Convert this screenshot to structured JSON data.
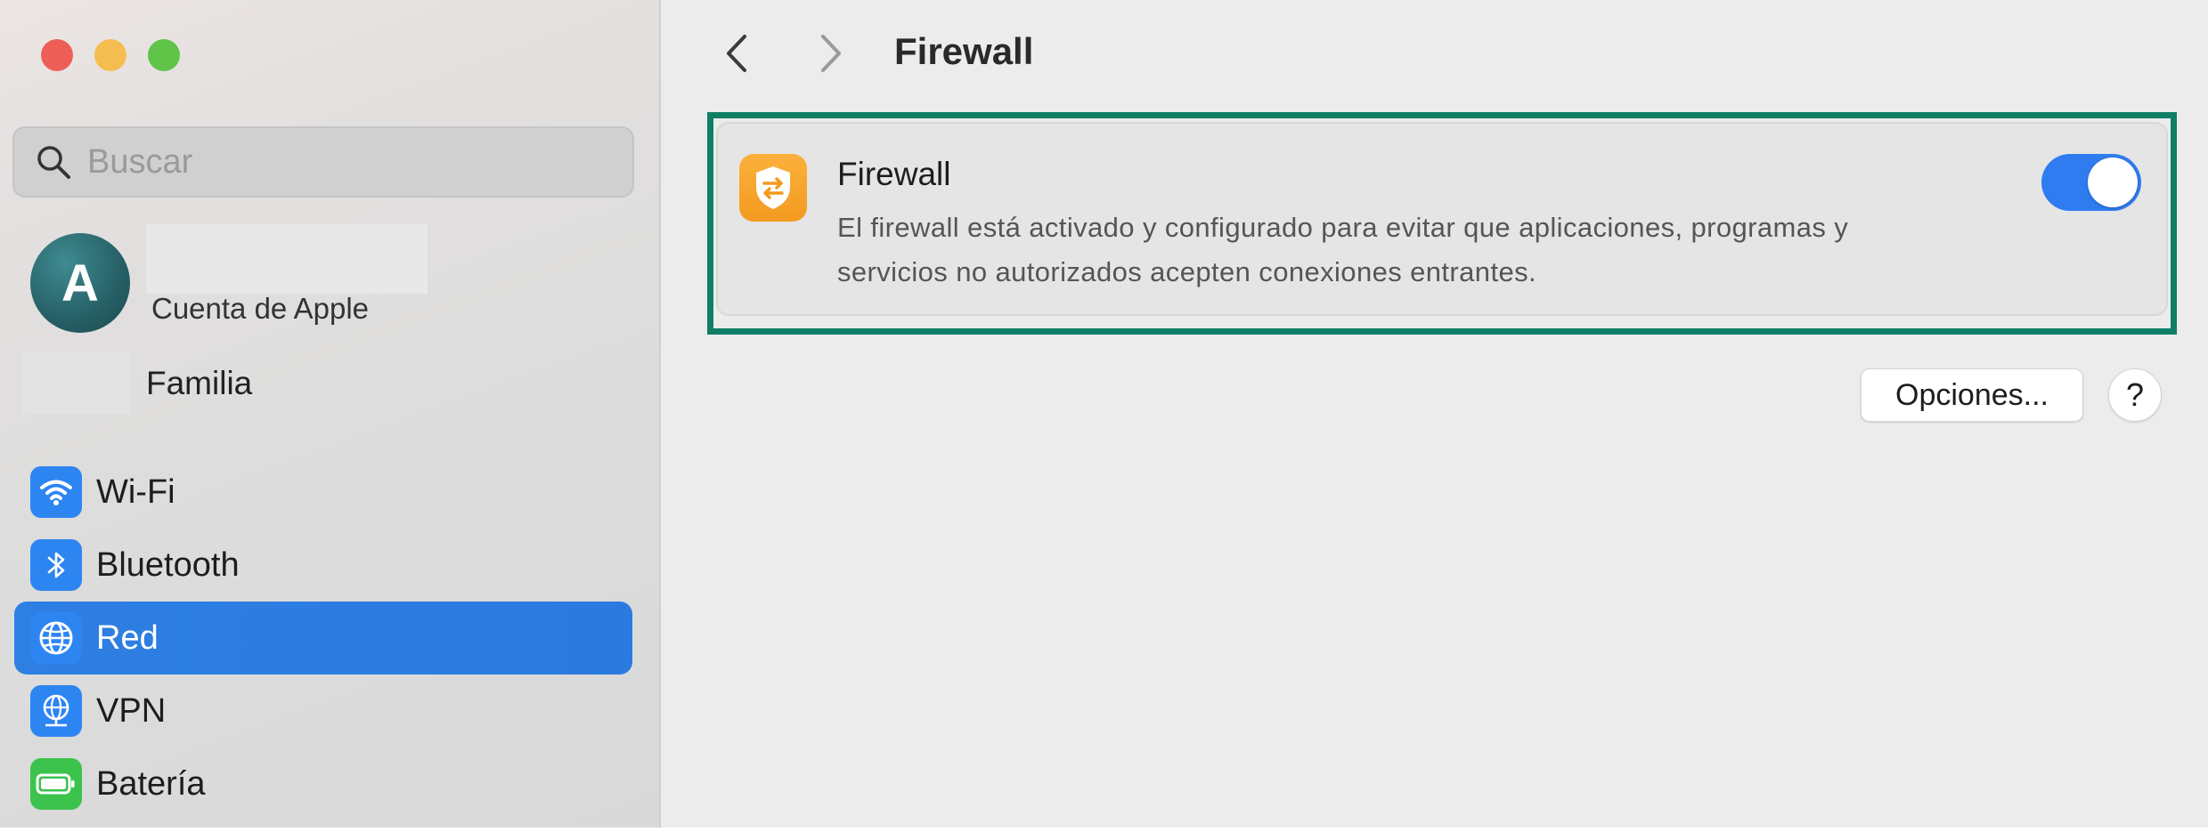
{
  "window": {
    "traffic_lights": {
      "close_color": "#ed5f56",
      "minimize_color": "#f5bd4f",
      "maximize_color": "#5fc448"
    }
  },
  "sidebar": {
    "search": {
      "placeholder": "Buscar",
      "value": ""
    },
    "account": {
      "avatar_letter": "A",
      "subtitle": "Cuenta de Apple"
    },
    "family": {
      "label": "Familia"
    },
    "items": [
      {
        "label": "Wi-Fi",
        "icon": "wifi-icon",
        "active": false
      },
      {
        "label": "Bluetooth",
        "icon": "bluetooth-icon",
        "active": false
      },
      {
        "label": "Red",
        "icon": "network-globe-icon",
        "active": true
      },
      {
        "label": "VPN",
        "icon": "vpn-globe-icon",
        "active": false
      },
      {
        "label": "Batería",
        "icon": "battery-icon",
        "active": false
      }
    ],
    "accent_color": "#2e7fe2"
  },
  "main": {
    "title": "Firewall",
    "firewall": {
      "title": "Firewall",
      "description": "El firewall está activado y configurado para evitar que aplicaciones, programas y servicios no autorizados acepten conexiones entrantes.",
      "enabled": true,
      "icon": "firewall-shield-icon",
      "highlight_color": "#0f7f66"
    },
    "buttons": {
      "options_label": "Opciones...",
      "help_label": "?"
    }
  }
}
